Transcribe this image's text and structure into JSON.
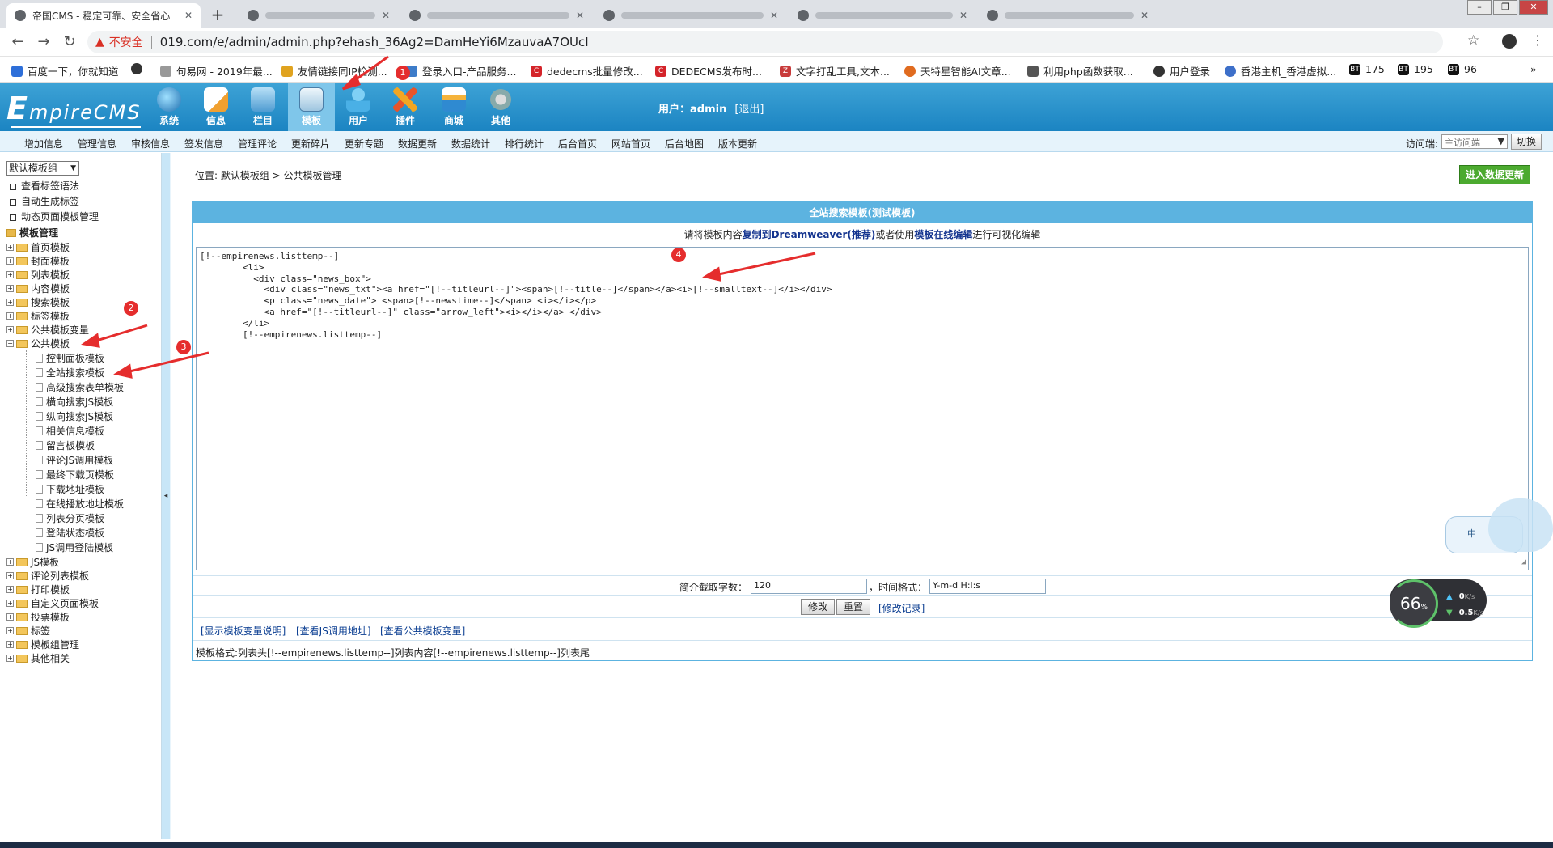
{
  "browser": {
    "tabs": [
      {
        "title": "帝国CMS - 稳定可靠、安全省心",
        "active": true
      },
      {
        "title": "",
        "active": false
      },
      {
        "title": "",
        "active": false
      },
      {
        "title": "",
        "active": false
      },
      {
        "title": "",
        "active": false
      },
      {
        "title": "",
        "active": false
      }
    ],
    "security_label": "不安全",
    "url": "019.com/e/admin/admin.php?ehash_36Ag2=DamHeYi6MzauvaA7OUcI",
    "bookmarks": [
      "百度一下，你就知道",
      "",
      "句易网 - 2019年最...",
      "友情链接同IP检测...",
      "登录入口-产品服务...",
      "dedecms批量修改...",
      "DEDECMS发布时...",
      "文字打乱工具,文本...",
      "天特星智能AI文章...",
      "利用php函数获取...",
      "用户登录",
      "香港主机_香港虚拟...",
      "175",
      "195",
      "96"
    ]
  },
  "cms": {
    "logo": "mpireCMS",
    "logo_initial": "E",
    "menu": [
      {
        "label": "系统",
        "icon": "globe-icon"
      },
      {
        "label": "信息",
        "icon": "edit-icon"
      },
      {
        "label": "栏目",
        "icon": "folder-icon"
      },
      {
        "label": "模板",
        "icon": "template-icon",
        "active": true
      },
      {
        "label": "用户",
        "icon": "user-icon"
      },
      {
        "label": "插件",
        "icon": "plugin-icon"
      },
      {
        "label": "商城",
        "icon": "shop-icon"
      },
      {
        "label": "其他",
        "icon": "gear-icon"
      }
    ],
    "user_label": "用户：admin",
    "logout": "[退出]",
    "sublinks": [
      "增加信息",
      "管理信息",
      "审核信息",
      "签发信息",
      "管理评论",
      "更新碎片",
      "更新专题",
      "数据更新",
      "数据统计",
      "排行统计",
      "后台首页",
      "网站首页",
      "后台地图",
      "版本更新"
    ],
    "lang_label": "访问端:",
    "lang_value": "主访问端",
    "switch_label": "切换"
  },
  "sidebar": {
    "group_select": "默认模板组",
    "links": [
      "查看标签语法",
      "自动生成标签",
      "动态页面模板管理"
    ],
    "section_title": "模板管理",
    "tree_top": [
      "首页模板",
      "封面模板",
      "列表模板",
      "内容模板",
      "搜索模板",
      "标签模板",
      "公共模板变量",
      "公共模板"
    ],
    "tree_children": [
      "控制面板模板",
      "全站搜索模板",
      "高级搜索表单模板",
      "横向搜索JS模板",
      "纵向搜索JS模板",
      "相关信息模板",
      "留言板模板",
      "评论JS调用模板",
      "最终下载页模板",
      "下载地址模板",
      "在线播放地址模板",
      "列表分页模板",
      "登陆状态模板",
      "JS调用登陆模板"
    ],
    "tree_bottom": [
      "JS模板",
      "评论列表模板",
      "打印模板",
      "自定义页面模板",
      "投票模板",
      "标签",
      "模板组管理",
      "其他相关"
    ]
  },
  "content": {
    "breadcrumb": "位置: 默认模板组  > 公共模板管理",
    "data_update_button": "进入数据更新",
    "panel_title": "全站搜索模板(测试模板)",
    "hint_pre": "请将模板内容",
    "hint_b1": "复制到Dreamweaver(推荐)",
    "hint_mid": "或者使用",
    "hint_b2": "模板在线编辑",
    "hint_post": "进行可视化编辑",
    "code": "[!--empirenews.listtemp--]\n        <li>\n          <div class=\"news_box\">\n            <div class=\"news_txt\"><a href=\"[!--titleurl--]\"><span>[!--title--]</span></a><i>[!--smalltext--]</i></div>\n            <p class=\"news_date\"> <span>[!--newstime--]</span> <i></i></p>\n            <a href=\"[!--titleurl--]\" class=\"arrow_left\"><i></i></a> </div>\n        </li>\n        [!--empirenews.listtemp--]",
    "intro_label": "简介截取字数：",
    "intro_value": "120",
    "time_label": "，时间格式：",
    "time_value": "Y-m-d H:i:s",
    "modify_button": "修改",
    "reset_button": "重置",
    "record_link": "[修改记录]",
    "help_links": [
      "[显示模板变量说明]",
      "[查看JS调用地址]",
      "[查看公共模板变量]"
    ],
    "format_note": "模板格式:列表头[!--empirenews.listtemp--]列表内容[!--empirenews.listtemp--]列表尾"
  },
  "widgets": {
    "ime_label": "中",
    "speed_percent": "66",
    "speed_unit": "%",
    "upload": "0",
    "upload_unit": "K/s",
    "download": "0.5",
    "download_unit": "K/s"
  },
  "annotations": [
    "1",
    "2",
    "3",
    "4"
  ]
}
